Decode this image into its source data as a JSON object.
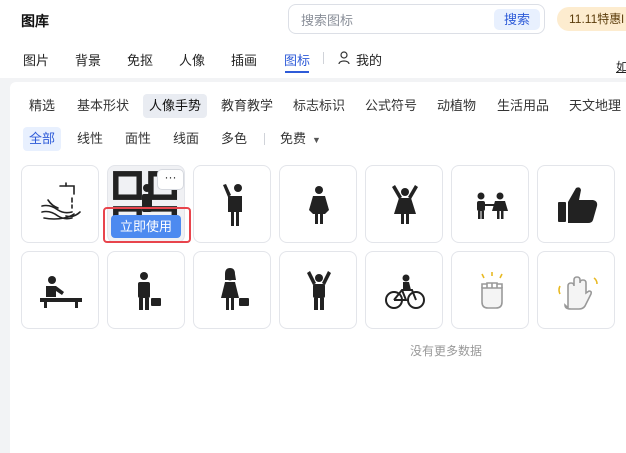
{
  "app": {
    "title": "图库"
  },
  "search": {
    "placeholder": "搜索图标",
    "button_label": "搜索"
  },
  "promo": {
    "label": "11.11特惠l"
  },
  "nav": {
    "items": [
      "图片",
      "背景",
      "免抠",
      "人像",
      "插画",
      "图标"
    ],
    "active_index": 5,
    "mine_label": "我的",
    "corner_label": "如"
  },
  "categories": {
    "items": [
      "精选",
      "基本形状",
      "人像手势",
      "教育教学",
      "标志标识",
      "公式符号",
      "动植物",
      "生活用品",
      "天文地理"
    ],
    "active_index": 2
  },
  "styles": {
    "items": [
      "全部",
      "线性",
      "面性",
      "线面",
      "多色"
    ],
    "active_index": 0,
    "price_filter": "免费"
  },
  "grid": {
    "icons": [
      "hand-wash-icon",
      "person-icon",
      "person-waving-icon",
      "woman-icon",
      "woman-cheering-icon",
      "children-icon",
      "thumbs-up-icon",
      "person-at-desk-icon",
      "businessman-icon",
      "businesswoman-icon",
      "man-cheering-icon",
      "cyclist-icon",
      "raised-fist-icon",
      "waving-hand-icon"
    ],
    "use_button_label": "立即使用",
    "more_label": "···",
    "empty_message": "没有更多数据"
  },
  "colors": {
    "accent": "#2e5bd8",
    "use_button": "#4d8af0",
    "highlight_frame": "#e8444c",
    "promo_bg": "#fdeccf",
    "icon_fill": "#222222"
  }
}
